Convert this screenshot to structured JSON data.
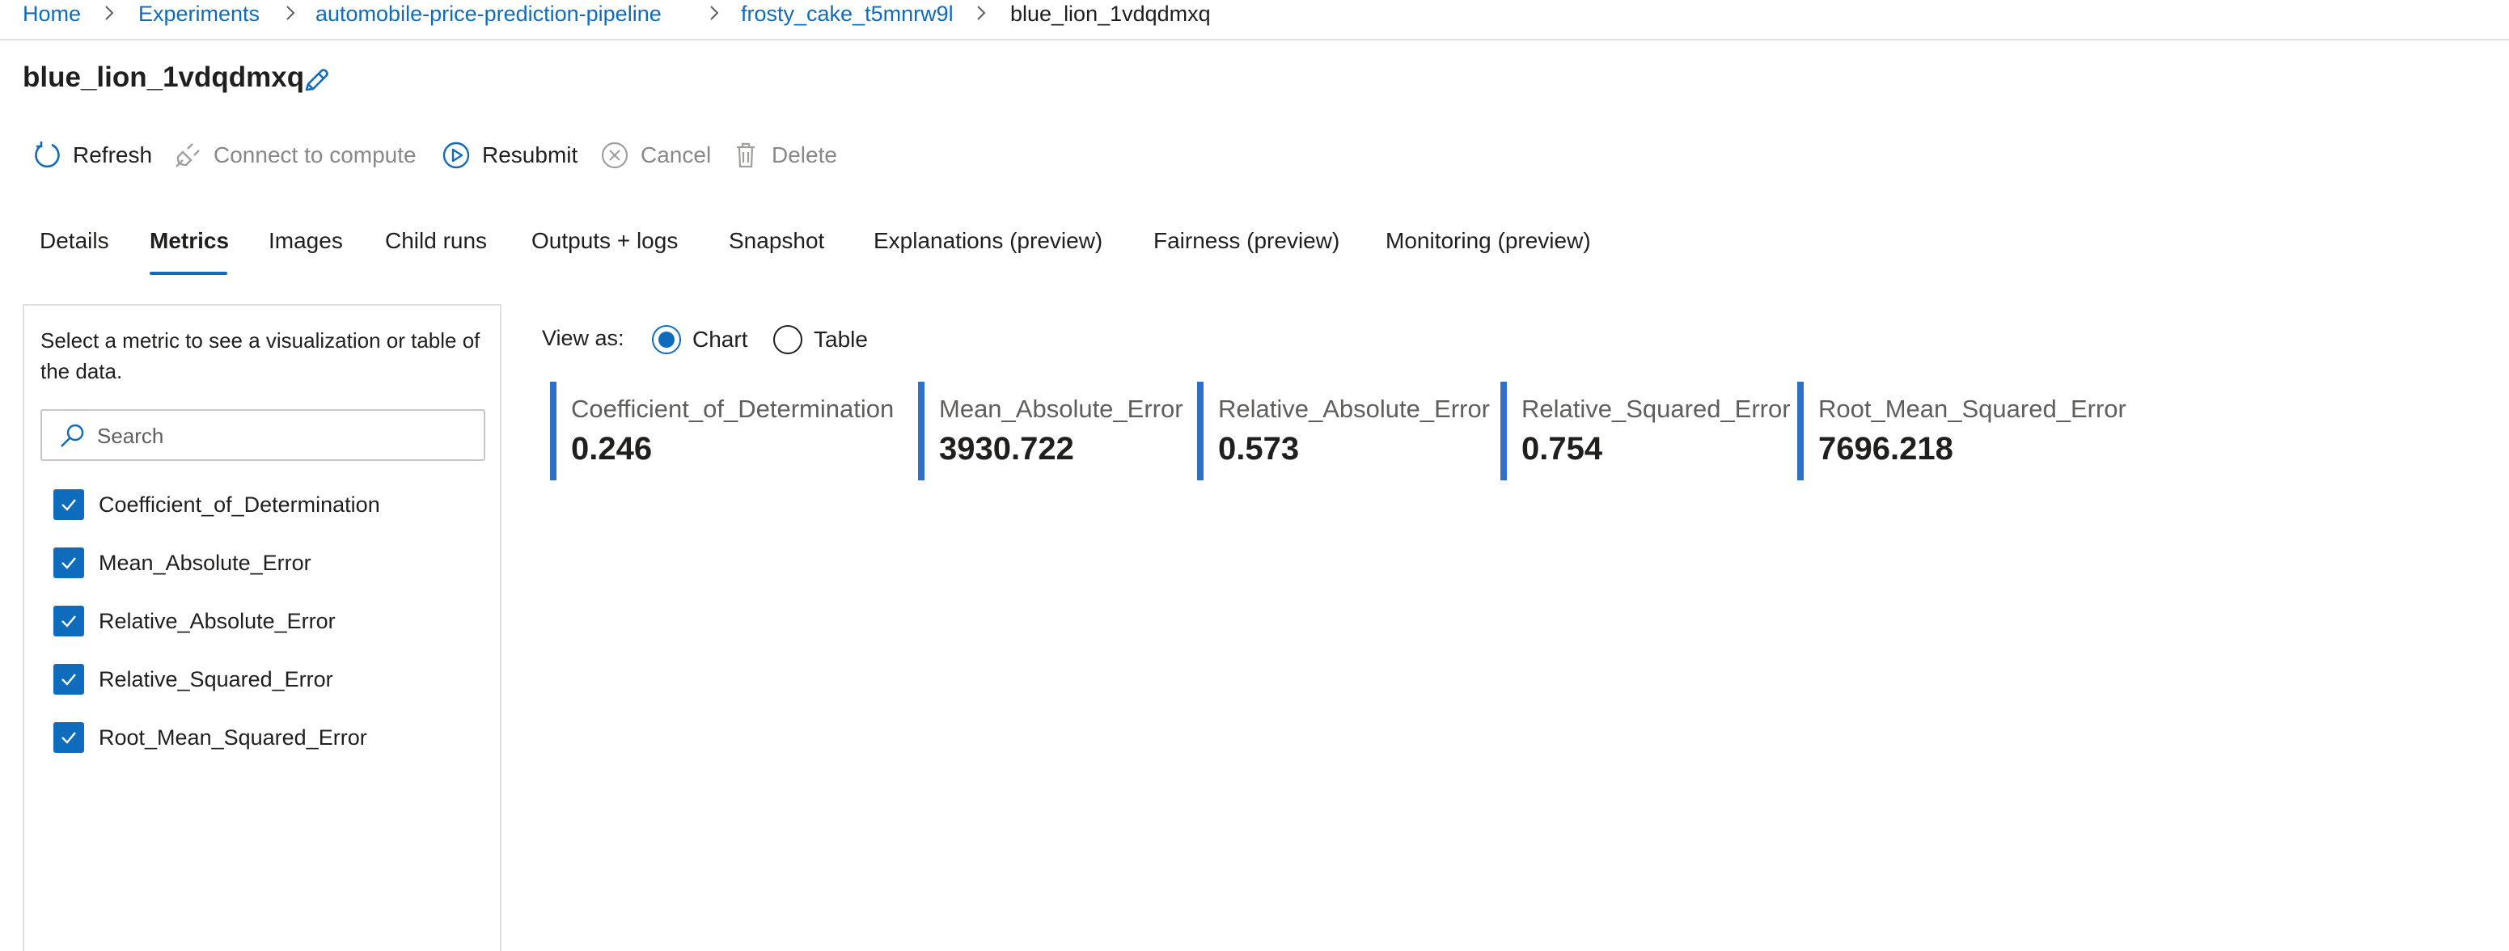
{
  "breadcrumb": {
    "items": [
      {
        "label": "Home"
      },
      {
        "label": "Experiments"
      },
      {
        "label": "automobile-price-prediction-pipeline"
      },
      {
        "label": "frosty_cake_t5mnrw9l"
      },
      {
        "label": "blue_lion_1vdqdmxq"
      }
    ]
  },
  "page": {
    "title": "blue_lion_1vdqdmxq",
    "edit_icon": "pencil-icon"
  },
  "toolbar": {
    "refresh": "Refresh",
    "connect": "Connect to compute",
    "resubmit": "Resubmit",
    "cancel": "Cancel",
    "delete": "Delete"
  },
  "tabs": [
    {
      "label": "Details"
    },
    {
      "label": "Metrics",
      "active": true
    },
    {
      "label": "Images"
    },
    {
      "label": "Child runs"
    },
    {
      "label": "Outputs + logs"
    },
    {
      "label": "Snapshot"
    },
    {
      "label": "Explanations (preview)"
    },
    {
      "label": "Fairness (preview)"
    },
    {
      "label": "Monitoring (preview)"
    }
  ],
  "sidebar": {
    "description": "Select a metric to see a visualization or table of the data.",
    "search_placeholder": "Search",
    "metrics": [
      {
        "label": "Coefficient_of_Determination",
        "checked": true
      },
      {
        "label": "Mean_Absolute_Error",
        "checked": true
      },
      {
        "label": "Relative_Absolute_Error",
        "checked": true
      },
      {
        "label": "Relative_Squared_Error",
        "checked": true
      },
      {
        "label": "Root_Mean_Squared_Error",
        "checked": true
      }
    ]
  },
  "view_as": {
    "label": "View as:",
    "options": [
      {
        "label": "Chart",
        "selected": true
      },
      {
        "label": "Table",
        "selected": false
      }
    ]
  },
  "metric_cards": [
    {
      "name": "Coefficient_of_Determination",
      "value": "0.246"
    },
    {
      "name": "Mean_Absolute_Error",
      "value": "3930.722"
    },
    {
      "name": "Relative_Absolute_Error",
      "value": "0.573"
    },
    {
      "name": "Relative_Squared_Error",
      "value": "0.754"
    },
    {
      "name": "Root_Mean_Squared_Error",
      "value": "7696.218"
    }
  ],
  "colors": {
    "accent": "#0f6cbd",
    "card_bar": "#2f6fc9",
    "text": "#201f1e",
    "disabled": "#8a8886"
  }
}
